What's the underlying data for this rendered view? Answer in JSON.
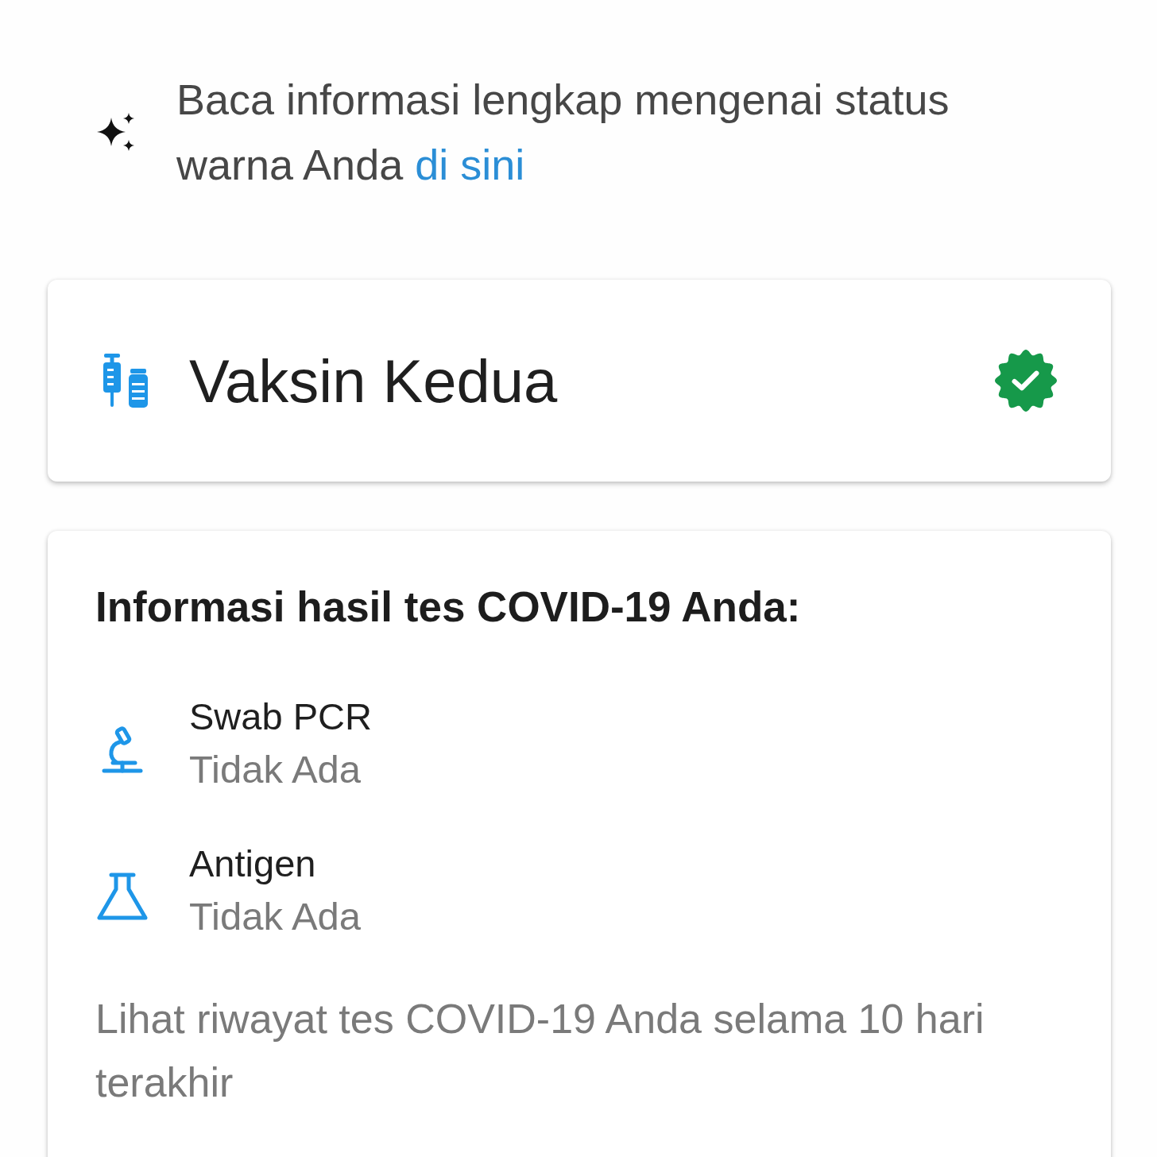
{
  "info": {
    "text": "Baca informasi lengkap mengenai status warna Anda",
    "link": "di sini"
  },
  "vaccine_card": {
    "title": "Vaksin Kedua",
    "verified": true
  },
  "test_card": {
    "heading": "Informasi hasil tes COVID-19 Anda:",
    "tests": [
      {
        "kind": "pcr",
        "name": "Swab PCR",
        "result": "Tidak Ada"
      },
      {
        "kind": "antigen",
        "name": "Antigen",
        "result": "Tidak Ada"
      }
    ],
    "history_text": "Lihat riwayat tes COVID-19 Anda selama 10 hari terakhir"
  }
}
